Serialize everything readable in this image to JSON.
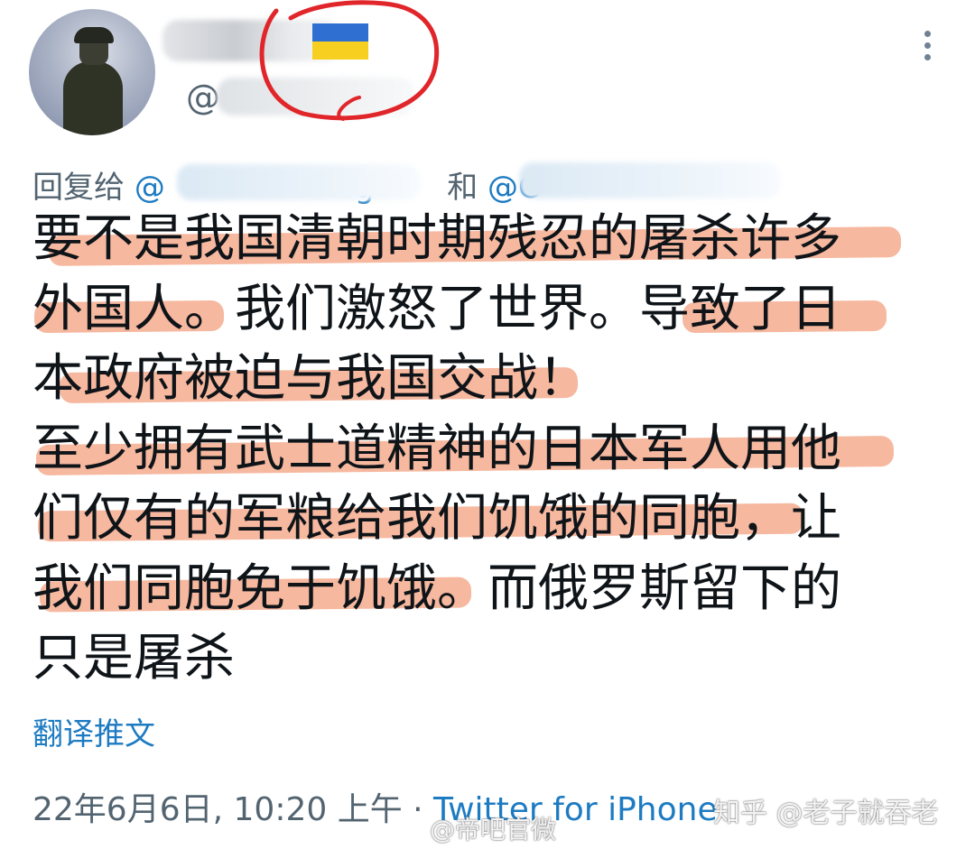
{
  "tweet": {
    "handle_prefix": "@",
    "reply_prefix": "回复给",
    "reply_mention_1": "@",
    "reply_mention_1_visible": "g",
    "reply_and": "和",
    "reply_mention_2": "@C",
    "text_lines": [
      "要不是我国清朝时期残忍的屠杀许多",
      "外国人。我们激怒了世界。导致了日",
      "本政府被迫与我国交战！",
      "至少拥有武士道精神的日本军人用他",
      "们仅有的军粮给我们饥饿的同胞，让",
      "我们同胞免于饥饿。而俄罗斯留下的",
      "只是屠杀"
    ],
    "translate_label": "翻译推文",
    "timestamp": "22年6月6日, 10:20 上午 · ",
    "client": "Twitter for iPhone"
  },
  "watermarks": {
    "left": "@帝吧官微",
    "right": "知乎 @老子就吞老"
  },
  "colors": {
    "highlight": "#f08c64",
    "link": "#1d7bc2",
    "secondary_text": "#536471",
    "annotation_circle": "#e0262a",
    "flag_blue": "#2f6fd1",
    "flag_yellow": "#f7cf20"
  }
}
